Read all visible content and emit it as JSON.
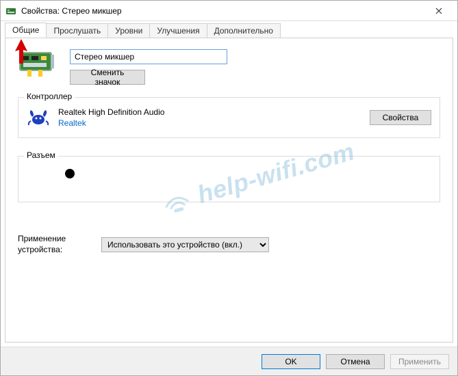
{
  "window": {
    "title": "Свойства: Стерео микшер"
  },
  "tabs": {
    "t0": "Общие",
    "t1": "Прослушать",
    "t2": "Уровни",
    "t3": "Улучшения",
    "t4": "Дополнительно"
  },
  "device": {
    "name": "Стерео микшер",
    "change_icon": "Сменить значок"
  },
  "controller": {
    "group_label": "Контроллер",
    "name": "Realtek High Definition Audio",
    "vendor": "Realtek",
    "properties_btn": "Свойства"
  },
  "jack": {
    "group_label": "Разъем"
  },
  "usage": {
    "label": "Применение устройства:",
    "selected": "Использовать это устройство (вкл.)"
  },
  "buttons": {
    "ok": "OK",
    "cancel": "Отмена",
    "apply": "Применить"
  },
  "watermark": "help-wifi.com"
}
